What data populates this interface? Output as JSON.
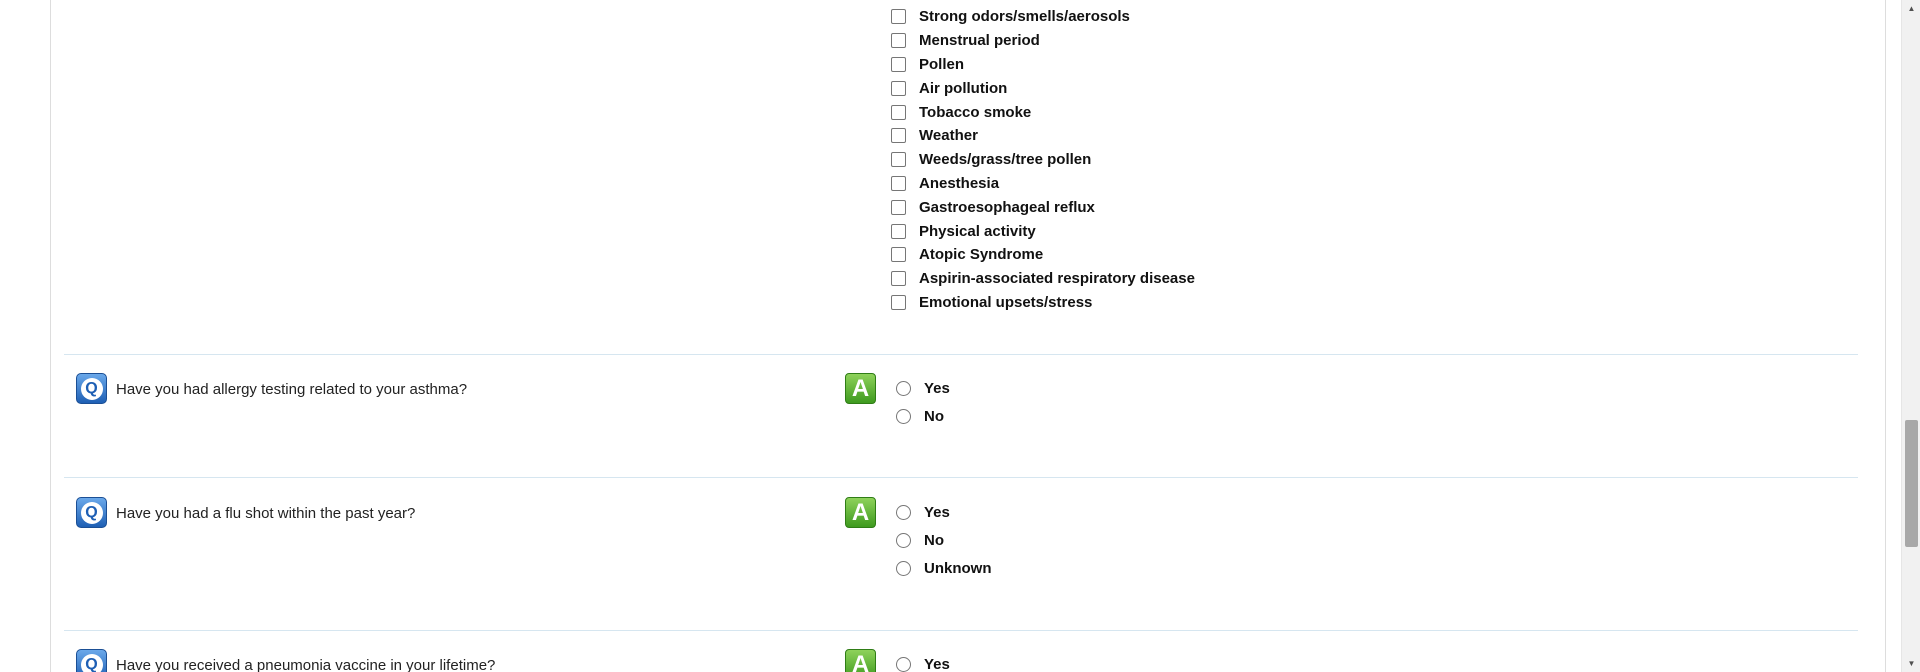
{
  "triggers": {
    "options": [
      "Strong odors/smells/aerosols",
      "Menstrual period",
      "Pollen",
      "Air pollution",
      "Tobacco smoke",
      "Weather",
      "Weeds/grass/tree pollen",
      "Anesthesia",
      "Gastroesophageal reflux",
      "Physical activity",
      "Atopic Syndrome",
      "Aspirin-associated respiratory disease",
      "Emotional upsets/stress"
    ]
  },
  "questions": [
    {
      "question_icon": "Q",
      "text": "Have you had allergy testing related to your asthma?",
      "answer_icon": "A",
      "options": [
        "Yes",
        "No"
      ]
    },
    {
      "question_icon": "Q",
      "text": "Have you had a flu shot within the past year?",
      "answer_icon": "A",
      "options": [
        "Yes",
        "No",
        "Unknown"
      ]
    },
    {
      "question_icon": "Q",
      "text": "Have you received a pneumonia vaccine in your lifetime?",
      "answer_icon": "A",
      "options": [
        "Yes"
      ]
    }
  ],
  "scrollbar": {
    "up_arrow": "▲",
    "down_arrow": "▼"
  },
  "colors": {
    "question_icon": "#1e5fb4",
    "answer_icon": "#3e9a1f",
    "divider": "#d6e6f0"
  }
}
